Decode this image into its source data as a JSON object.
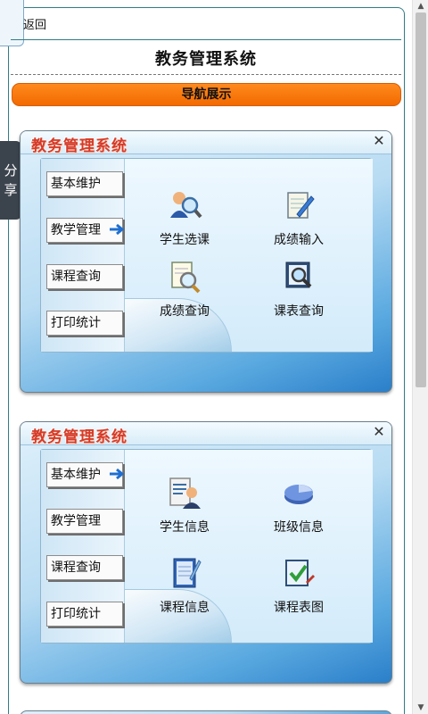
{
  "header": {
    "back_label": "返回",
    "title": "教务管理系统",
    "nav_label": "导航展示"
  },
  "share_tab": {
    "char1": "分",
    "char2": "享"
  },
  "panels": [
    {
      "title": "教务管理系统",
      "close": "✕",
      "menu": [
        "基本维护",
        "教学管理",
        "课程查询",
        "打印统计"
      ],
      "active_menu": "教学管理",
      "functions": [
        {
          "label": "学生选课",
          "icon": "student-search-icon"
        },
        {
          "label": "成绩输入",
          "icon": "notepad-pen-icon"
        },
        {
          "label": "成绩查询",
          "icon": "document-magnifier-icon"
        },
        {
          "label": "课表查询",
          "icon": "schedule-magnifier-icon"
        }
      ]
    },
    {
      "title": "教务管理系统",
      "close": "✕",
      "menu": [
        "基本维护",
        "教学管理",
        "课程查询",
        "打印统计"
      ],
      "active_menu": "基本维护",
      "functions": [
        {
          "label": "学生信息",
          "icon": "student-info-icon"
        },
        {
          "label": "班级信息",
          "icon": "pie-chart-icon"
        },
        {
          "label": "课程信息",
          "icon": "notebook-icon"
        },
        {
          "label": "课程表图",
          "icon": "checklist-icon"
        }
      ]
    }
  ],
  "colors": {
    "nav_orange": "#f26a00",
    "frame_teal": "#2f7d86",
    "panel_title_red": "#d43b2a"
  }
}
